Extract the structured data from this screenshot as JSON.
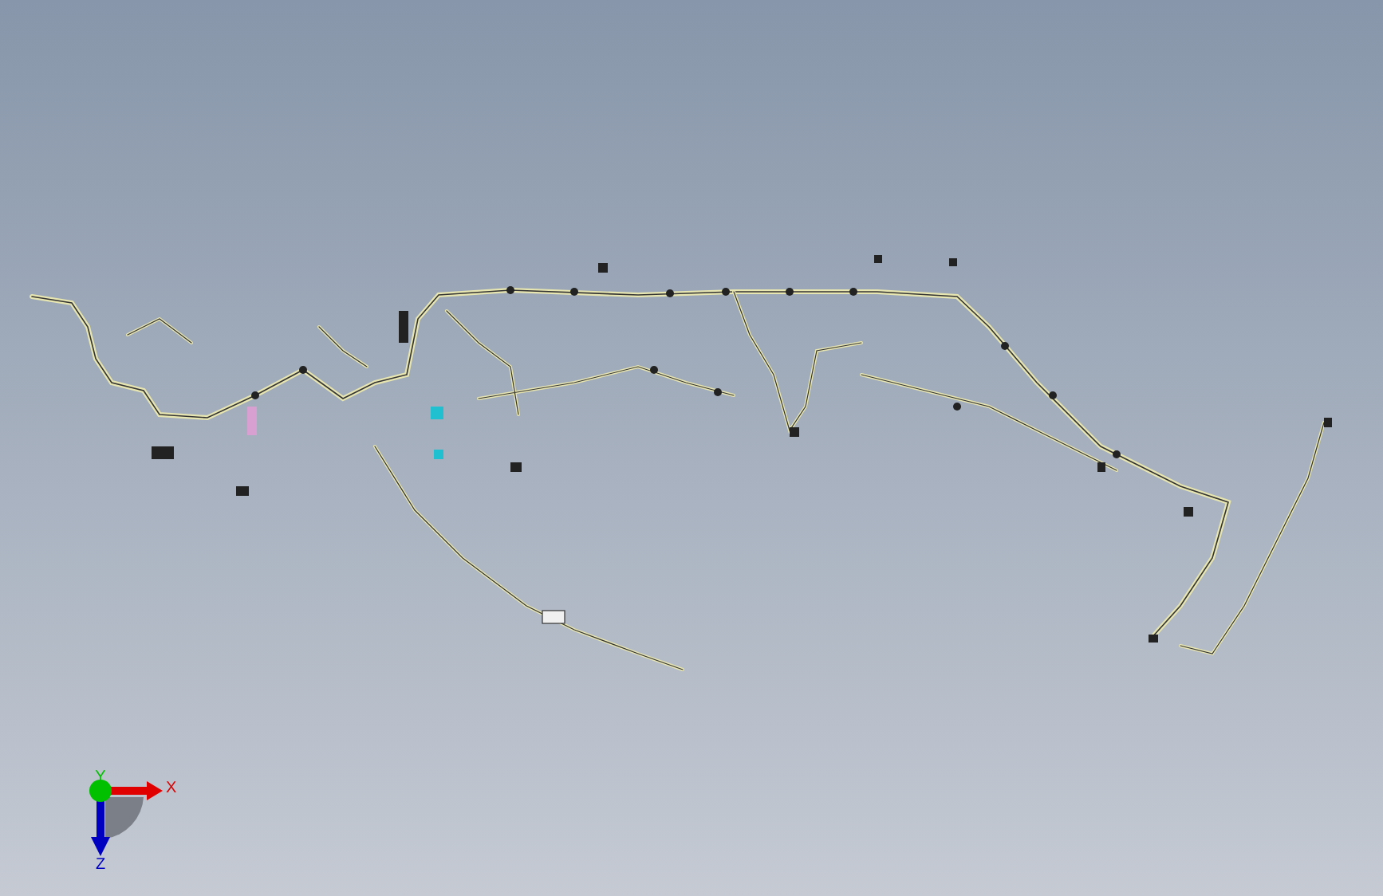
{
  "viewport": {
    "triad": {
      "axes": [
        {
          "kind": "x",
          "label": "X",
          "color": "#e00000"
        },
        {
          "kind": "y",
          "label": "Y",
          "color": "#00c000"
        },
        {
          "kind": "z",
          "label": "Z",
          "color": "#0000c0"
        }
      ]
    }
  }
}
